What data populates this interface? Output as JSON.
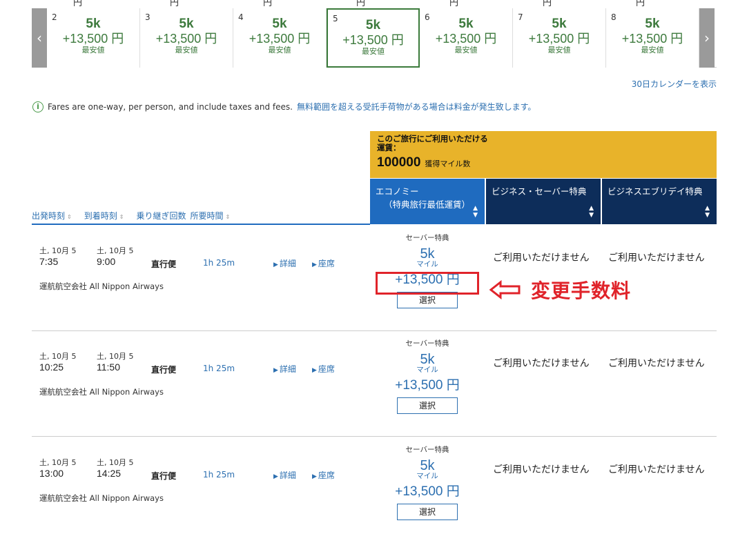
{
  "top_strip": [
    "円",
    "円",
    "円",
    "円",
    "円",
    "円",
    "円"
  ],
  "carousel": {
    "prev_icon": "chevron-left",
    "next_icon": "chevron-right",
    "days": [
      {
        "day": "2",
        "miles": "5k",
        "fee": "+13,500 円",
        "note": "最安値"
      },
      {
        "day": "3",
        "miles": "5k",
        "fee": "+13,500 円",
        "note": "最安値"
      },
      {
        "day": "4",
        "miles": "5k",
        "fee": "+13,500 円",
        "note": "最安値"
      },
      {
        "day": "5",
        "miles": "5k",
        "fee": "+13,500 円",
        "note": "最安値"
      },
      {
        "day": "6",
        "miles": "5k",
        "fee": "+13,500 円",
        "note": "最安値"
      },
      {
        "day": "7",
        "miles": "5k",
        "fee": "+13,500 円",
        "note": "最安値"
      },
      {
        "day": "8",
        "miles": "5k",
        "fee": "+13,500 円",
        "note": "最安値"
      }
    ]
  },
  "calendar_link": "30日カレンダーを表示",
  "info": {
    "text": "Fares are one-way, per person, and include taxes and fees.",
    "link": "無料範囲を超える受託手荷物がある場合は料金が発生致します。"
  },
  "award_box": {
    "title_line1": "このご旅行にご利用いただける",
    "title_line2": "運賃：",
    "points": "100000",
    "points_label": "獲得マイル数"
  },
  "columns": {
    "economy_line1": "エコノミー",
    "economy_line2": "（特典旅行最低運賃）",
    "business_saver": "ビジネス・セーバー特典",
    "business_any": "ビジネスエブリデイ特典"
  },
  "sort_bar": {
    "departure": "出発時刻",
    "arrival": "到着時刻",
    "stops": "乗り継ぎ回数",
    "duration": "所要時間"
  },
  "flights": [
    {
      "dep_date": "土, 10月 5",
      "dep_time": "7:35",
      "arr_date": "土, 10月 5",
      "arr_time": "9:00",
      "stops": "直行便",
      "duration": "1h 25m",
      "details": "詳細",
      "seats": "座席",
      "operated_by": "運航航空会社 All Nippon Airways",
      "saver": "セーバー特典",
      "miles": "5k",
      "miles_unit": "マイル",
      "fee": "+13,500 円",
      "select": "選択",
      "unavail1": "ご利用いただけません",
      "unavail2": "ご利用いただけません"
    },
    {
      "dep_date": "土, 10月 5",
      "dep_time": "10:25",
      "arr_date": "土, 10月 5",
      "arr_time": "11:50",
      "stops": "直行便",
      "duration": "1h 25m",
      "details": "詳細",
      "seats": "座席",
      "operated_by": "運航航空会社 All Nippon Airways",
      "saver": "セーバー特典",
      "miles": "5k",
      "miles_unit": "マイル",
      "fee": "+13,500 円",
      "select": "選択",
      "unavail1": "ご利用いただけません",
      "unavail2": "ご利用いただけません"
    },
    {
      "dep_date": "土, 10月 5",
      "dep_time": "13:00",
      "arr_date": "土, 10月 5",
      "arr_time": "14:25",
      "stops": "直行便",
      "duration": "1h 25m",
      "details": "詳細",
      "seats": "座席",
      "operated_by": "運航航空会社 All Nippon Airways",
      "saver": "セーバー特典",
      "miles": "5k",
      "miles_unit": "マイル",
      "fee": "+13,500 円",
      "select": "選択",
      "unavail1": "ご利用いただけません",
      "unavail2": "ご利用いただけません"
    }
  ],
  "annotation": {
    "text": "変更手数料",
    "color": "#e0232a"
  },
  "colors": {
    "brand_blue": "#1f6bbf",
    "dark_navy": "#0d2d5a",
    "gold": "#e8b32a",
    "green": "#3d7a3d",
    "link_blue": "#2c6fb0"
  }
}
